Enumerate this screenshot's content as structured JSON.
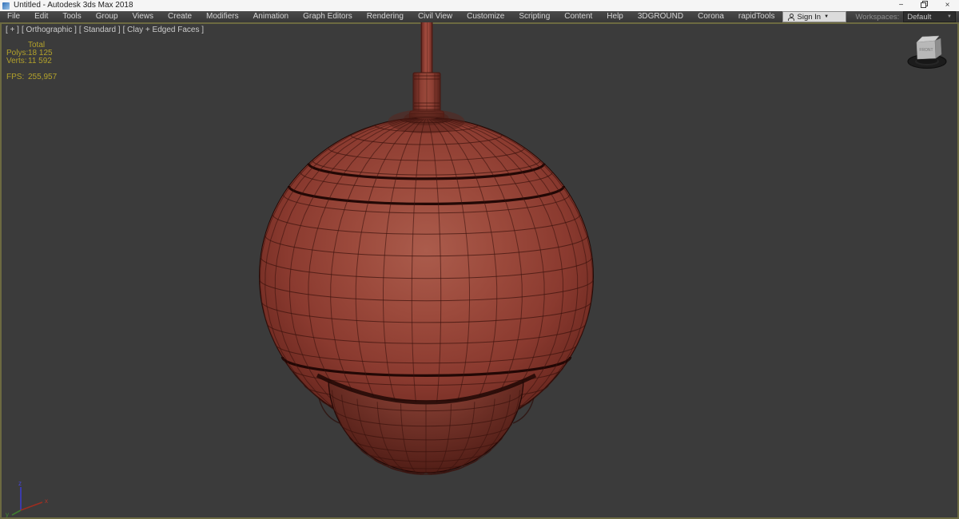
{
  "window": {
    "title": "Untitled - Autodesk 3ds Max 2018",
    "minimize_glyph": "−",
    "close_glyph": "×"
  },
  "menu": {
    "items": [
      "File",
      "Edit",
      "Tools",
      "Group",
      "Views",
      "Create",
      "Modifiers",
      "Animation",
      "Graph Editors",
      "Rendering",
      "Civil View",
      "Customize",
      "Scripting",
      "Content",
      "Help",
      "3DGROUND",
      "Corona",
      "rapidTools"
    ]
  },
  "account": {
    "sign_in": "Sign In"
  },
  "workspaces": {
    "label": "Workspaces:",
    "value": "Default"
  },
  "viewport": {
    "label": {
      "plus": "[ + ]",
      "view": "[ Orthographic ]",
      "render_preset": "[ Standard ]",
      "shading": "[ Clay + Edged Faces ]"
    },
    "stats": {
      "header": "Total",
      "rows": [
        {
          "label": "Polys:",
          "value": "18 125"
        },
        {
          "label": "Verts:",
          "value": "11 592"
        }
      ],
      "fps_label": "FPS:",
      "fps_value": "255,957"
    },
    "viewcube": {
      "face": "FRONT"
    },
    "axis": {
      "x": "x",
      "y": "y",
      "z": "z"
    },
    "colors": {
      "background": "#3b3b3b",
      "active_border": "#6c6a41",
      "clay": "#9c4a3c",
      "wire": "#3a120d",
      "stats_text": "#b3a22b"
    }
  }
}
